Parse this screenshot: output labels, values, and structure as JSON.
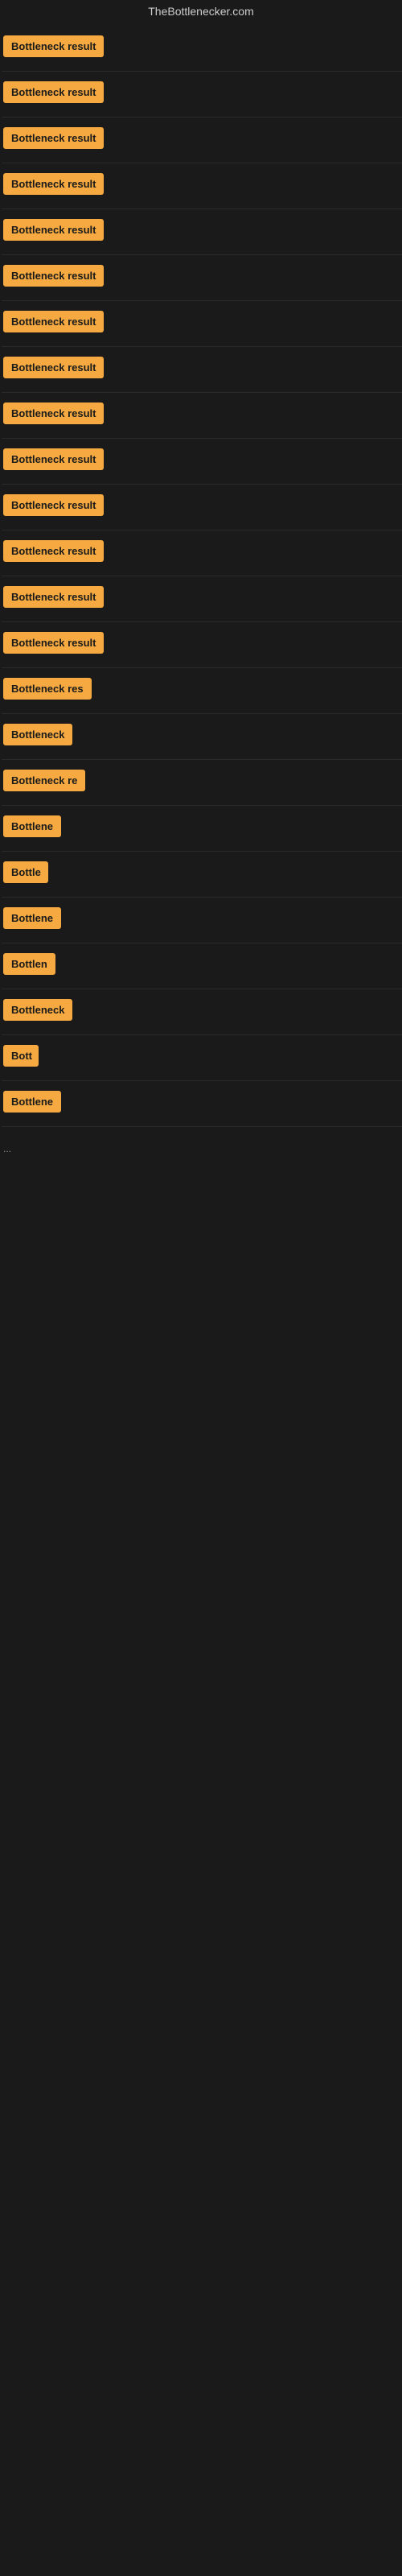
{
  "site": {
    "title": "TheBottlenecker.com"
  },
  "results": [
    {
      "id": 1,
      "label": "Bottleneck result",
      "width": 140
    },
    {
      "id": 2,
      "label": "Bottleneck result",
      "width": 140
    },
    {
      "id": 3,
      "label": "Bottleneck result",
      "width": 140
    },
    {
      "id": 4,
      "label": "Bottleneck result",
      "width": 140
    },
    {
      "id": 5,
      "label": "Bottleneck result",
      "width": 140
    },
    {
      "id": 6,
      "label": "Bottleneck result",
      "width": 140
    },
    {
      "id": 7,
      "label": "Bottleneck result",
      "width": 140
    },
    {
      "id": 8,
      "label": "Bottleneck result",
      "width": 140
    },
    {
      "id": 9,
      "label": "Bottleneck result",
      "width": 140
    },
    {
      "id": 10,
      "label": "Bottleneck result",
      "width": 140
    },
    {
      "id": 11,
      "label": "Bottleneck result",
      "width": 140
    },
    {
      "id": 12,
      "label": "Bottleneck result",
      "width": 140
    },
    {
      "id": 13,
      "label": "Bottleneck result",
      "width": 140
    },
    {
      "id": 14,
      "label": "Bottleneck result",
      "width": 140
    },
    {
      "id": 15,
      "label": "Bottleneck res",
      "width": 118
    },
    {
      "id": 16,
      "label": "Bottleneck",
      "width": 86
    },
    {
      "id": 17,
      "label": "Bottleneck re",
      "width": 104
    },
    {
      "id": 18,
      "label": "Bottlene",
      "width": 72
    },
    {
      "id": 19,
      "label": "Bottle",
      "width": 56
    },
    {
      "id": 20,
      "label": "Bottlene",
      "width": 72
    },
    {
      "id": 21,
      "label": "Bottlen",
      "width": 66
    },
    {
      "id": 22,
      "label": "Bottleneck",
      "width": 86
    },
    {
      "id": 23,
      "label": "Bott",
      "width": 44
    },
    {
      "id": 24,
      "label": "Bottlene",
      "width": 72
    }
  ],
  "ellipsis": "..."
}
